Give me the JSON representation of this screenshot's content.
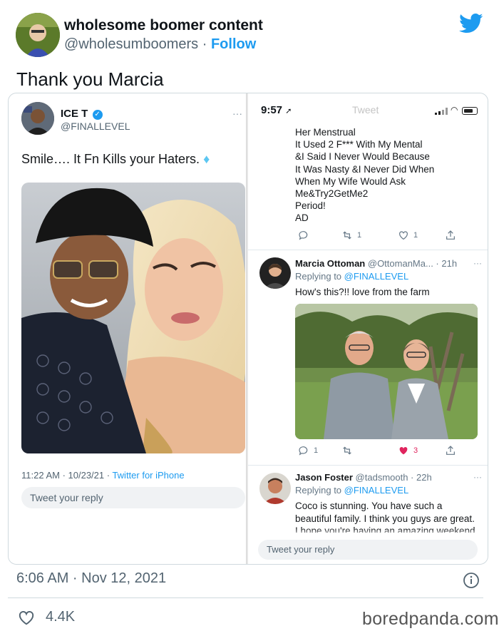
{
  "header": {
    "display_name": "wholesome boomer content",
    "handle": "@wholesumboomers",
    "separator": "·",
    "follow_label": "Follow"
  },
  "tweet": {
    "text": "Thank you Marcia",
    "timestamp": "6:06 AM · Nov 12, 2021",
    "likes": "4.4K"
  },
  "left_panel": {
    "name": "ICE T",
    "handle": "@FINALLEVEL",
    "text": "Smile…. It Fn Kills your Haters.",
    "emoji": "💎",
    "meta_time": "11:22 AM · 10/23/21 · ",
    "meta_source": "Twitter for iPhone",
    "reply_placeholder": "Tweet your reply"
  },
  "right_panel": {
    "time": "9:57",
    "nav_title": "Tweet",
    "poem": [
      "Her Menstrual",
      "It Used 2 F*** With My Mental",
      "&I Said I Never Would Because",
      "It Was Nasty &I Never Did When",
      "When My Wife Would Ask",
      "Me&Try2GetMe2",
      "Period!",
      "AD"
    ],
    "poem_actions": {
      "retweets": "1",
      "likes": "1"
    },
    "replies": [
      {
        "name": "Marcia Ottoman",
        "handle_time": "@OttomanMa... · 21h",
        "replying_prefix": "Replying to ",
        "mention": "@FINALLEVEL",
        "text": "How's this?!! love from the farm",
        "replies": "1",
        "likes": "3"
      },
      {
        "name": "Jason Foster",
        "handle_time": "@tadsmooth · 22h",
        "replying_prefix": "Replying to ",
        "mention": "@FINALLEVEL",
        "text_lines": [
          "Coco is stunning. You have such a",
          "beautiful family. I think you guys are great.",
          "I hope you're having an amazing weekend"
        ]
      }
    ],
    "reply_placeholder": "Tweet your reply"
  },
  "watermark": "boredpanda.com",
  "colors": {
    "accent": "#1d9bf0",
    "text": "#0f1419",
    "muted": "#536471",
    "like_pink": "#e0245e"
  }
}
